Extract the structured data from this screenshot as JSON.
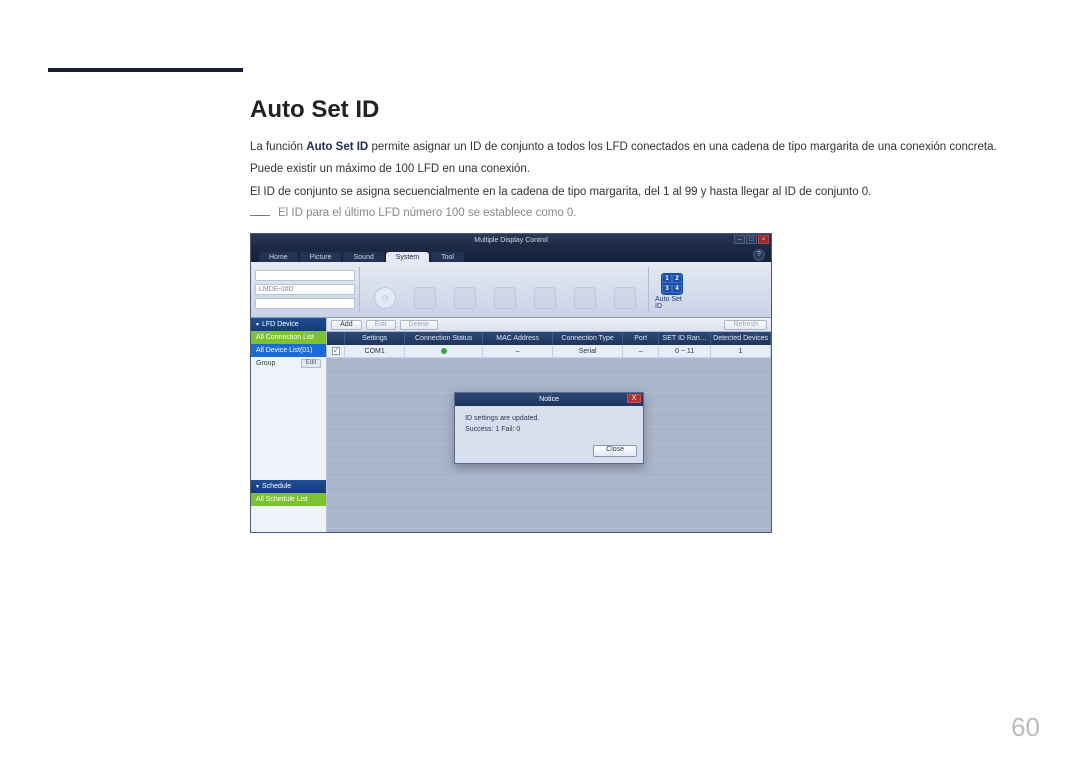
{
  "doc": {
    "heading": "Auto Set ID",
    "p1_pre": "La función ",
    "p1_bold": "Auto Set ID",
    "p1_post": " permite asignar un ID de conjunto a todos los LFD conectados en una cadena de tipo margarita de una conexión concreta.",
    "p2": "Puede existir un máximo de 100 LFD en una conexión.",
    "p3": "El ID de conjunto se asigna secuencialmente en la cadena de tipo margarita, del 1 al 99 y hasta llegar al ID de conjunto 0.",
    "note": "El ID para el último LFD número 100 se establece como 0.",
    "page_number": "60"
  },
  "app": {
    "title": "Multiple Display Control",
    "win_min": "–",
    "win_max": "□",
    "win_close": "×",
    "tabs": {
      "home": "Home",
      "picture": "Picture",
      "sound": "Sound",
      "system": "System",
      "tool": "Tool"
    },
    "help": "?",
    "left_fields": {
      "f1": "",
      "f2": "LMDE-0#D",
      "f3": ""
    },
    "ribbon": {
      "clock": "",
      "i2": "",
      "i3": "",
      "i4": "",
      "i5": "",
      "i6": "",
      "i7": "",
      "auto": {
        "g1": "1",
        "g2": "2",
        "g3": "3",
        "g4": "4",
        "label": "Auto Set ID"
      }
    },
    "sidebar": {
      "lfd": "LFD Device",
      "conn": "All Connection List",
      "dev": "All Device List(01)",
      "group": "Group",
      "edit": "Edit",
      "schedule": "Schedule",
      "sched_list": "All Schedule List"
    },
    "toolbar": {
      "add": "Add",
      "edit": "Edit",
      "delete": "Delete",
      "refresh": "Refresh"
    },
    "columns": {
      "c1": "Settings",
      "c2": "Connection Status",
      "c3": "MAC Address",
      "c4": "Connection Type",
      "c5": "Port",
      "c6": "SET ID Ran…",
      "c7": "Detected Devices"
    },
    "row": {
      "settings": "COM1",
      "mac": "–",
      "type": "Serial",
      "port": "–",
      "range": "0 ~ 11",
      "detected": "1"
    },
    "dialog": {
      "title": "Notice",
      "line1": "ID settings are updated.",
      "line2": "Success: 1  Fail: 0",
      "close": "Close",
      "x": "X"
    }
  }
}
